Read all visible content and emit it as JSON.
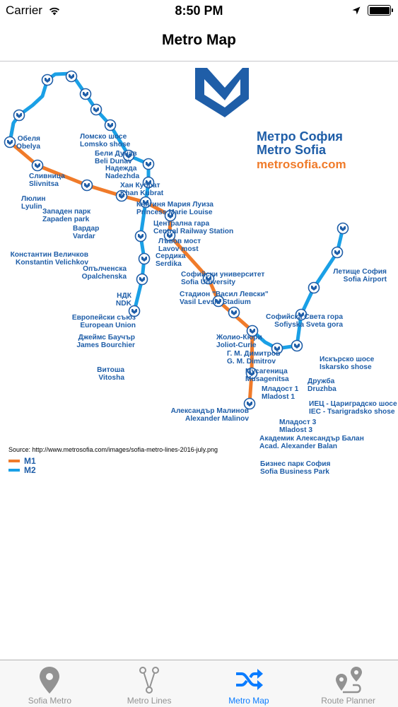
{
  "status_bar": {
    "carrier": "Carrier",
    "time": "8:50 PM"
  },
  "nav": {
    "title": "Metro Map"
  },
  "map": {
    "logo_bg": "Метро София",
    "logo_en": "Metro Sofia",
    "logo_web": "metrosofia.com",
    "source": "Source: http://www.metrosofia.com/images/sofia-metro-lines-2016-july.png",
    "legend": [
      {
        "label": "M1",
        "color": "#f07b2a"
      },
      {
        "label": "M2",
        "color": "#1aa0e6"
      }
    ],
    "stations": {
      "obelya": {
        "bg": "Обеля",
        "en": "Obelya"
      },
      "lomsko": {
        "bg": "Ломско шосе",
        "en": "Lomsko shose"
      },
      "beli_dunav": {
        "bg": "Бели Дунав",
        "en": "Beli Dunav"
      },
      "nadezhda": {
        "bg": "Надежда",
        "en": "Nadezhda"
      },
      "khan_kubrat": {
        "bg": "Хан Кубрат",
        "en": "Khan Kubrat"
      },
      "princess": {
        "bg": "Княгиня Мария Луиза",
        "en": "Princess Marie Louise"
      },
      "central": {
        "bg": "Централна гара",
        "en": "Central Railway Station"
      },
      "lavov": {
        "bg": "Лъвов мост",
        "en": "Lavov most"
      },
      "serdika": {
        "bg": "Сердика",
        "en": "Serdika"
      },
      "slivnitsa": {
        "bg": "Сливница",
        "en": "Slivnitsa"
      },
      "lyulin": {
        "bg": "Люлин",
        "en": "Lyulin"
      },
      "zapaden": {
        "bg": "Западен парк",
        "en": "Zapaden park"
      },
      "vardar": {
        "bg": "Вардар",
        "en": "Vardar"
      },
      "velichkov": {
        "bg": "Константин Величков",
        "en": "Konstantin Velichkov"
      },
      "opalchenska": {
        "bg": "Опълченска",
        "en": "Opalchenska"
      },
      "sofia_univ": {
        "bg": "Софийски университет",
        "en": "Sofia University"
      },
      "ndk": {
        "bg": "НДК",
        "en": "NDK"
      },
      "vasil": {
        "bg": "Стадион \"Васил Левски\"",
        "en": "Vasil Levski Stadium"
      },
      "european": {
        "bg": "Европейски съюз",
        "en": "European Union"
      },
      "bourchier": {
        "bg": "Джеймс Баучър",
        "en": "James Bourchier"
      },
      "vitosha": {
        "bg": "Витоша",
        "en": "Vitosha"
      },
      "joliot": {
        "bg": "Жолио-Кюри",
        "en": "Joliot-Curie"
      },
      "dimitrov": {
        "bg": "Г. М. Димитров",
        "en": "G. M. Dimitrov"
      },
      "musagenitsa": {
        "bg": "Мусагеница",
        "en": "Musagenitsa"
      },
      "mladost1": {
        "bg": "Младост 1",
        "en": "Mladost 1"
      },
      "airport": {
        "bg": "Летище София",
        "en": "Sofia Airport"
      },
      "sveta_gora": {
        "bg": "Софийска Света гора",
        "en": "Sofiyska Sveta gora"
      },
      "iskarsko": {
        "bg": "Искърско шосе",
        "en": "Iskarsko shose"
      },
      "druzhba": {
        "bg": "Дружба",
        "en": "Druzhba"
      },
      "iec": {
        "bg": "ИЕЦ - Цариградско шосе",
        "en": "IEC - Tsarigradsko shose"
      },
      "malinov": {
        "bg": "Александър Малинов",
        "en": "Alexander Malinov"
      },
      "mladost3": {
        "bg": "Младост 3",
        "en": "Mladost 3"
      },
      "balan": {
        "bg": "Академик Александър Балан",
        "en": "Acad. Alexander Balan"
      },
      "business": {
        "bg": "Бизнес парк София",
        "en": "Sofia Business Park"
      }
    }
  },
  "tabs": [
    {
      "label": "Sofia Metro",
      "icon": "map-pin-icon",
      "active": false
    },
    {
      "label": "Metro Lines",
      "icon": "branch-icon",
      "active": false
    },
    {
      "label": "Metro Map",
      "icon": "shuffle-icon",
      "active": true
    },
    {
      "label": "Route Planner",
      "icon": "route-icon",
      "active": false
    }
  ],
  "colors": {
    "m1": "#f07b2a",
    "m2": "#1aa0e6",
    "label": "#1f5ea8",
    "active_tab": "#0a7cff",
    "inactive_tab": "#929292"
  }
}
